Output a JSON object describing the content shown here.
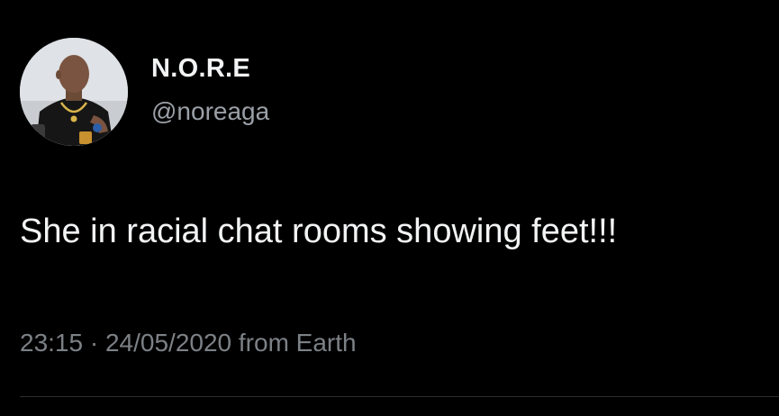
{
  "author": {
    "display_name": "N.O.R.E",
    "handle": "@noreaga",
    "avatar_icon": "profile-photo"
  },
  "tweet": {
    "text": "She in racial chat rooms showing feet!!!",
    "time": "23:15",
    "separator": "·",
    "date": "24/05/2020",
    "source": "from Earth"
  },
  "colors": {
    "background": "#000000",
    "primary_text": "#f2f3f4",
    "secondary_text": "#9aa0a6",
    "meta_text": "#7c8186"
  }
}
